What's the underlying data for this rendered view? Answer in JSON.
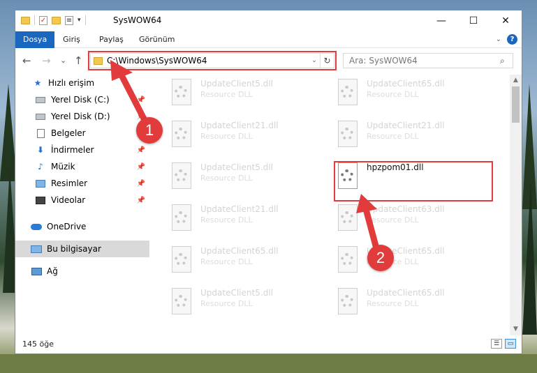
{
  "window": {
    "title": "SysWOW64",
    "controls": {
      "minimize": "—",
      "maximize": "☐",
      "close": "✕"
    }
  },
  "qat_icons": [
    "folder-icon",
    "checkmark-icon",
    "folder-icon",
    "properties-icon",
    "dropdown-icon"
  ],
  "ribbon": {
    "tabs": [
      "Dosya",
      "Giriş",
      "Paylaş",
      "Görünüm"
    ],
    "help": "?"
  },
  "nav": {
    "back": "←",
    "forward": "→",
    "recent": "⌄",
    "up": "↑",
    "address": "C:\\Windows\\SysWOW64",
    "refresh": "↻",
    "search_placeholder": "Ara: SysWOW64",
    "search_icon": "⌕"
  },
  "sidebar": {
    "items": [
      {
        "label": "Hızlı erişim",
        "icon": "star-icon",
        "pinned": false
      },
      {
        "label": "Yerel Disk (C:)",
        "icon": "drive-icon",
        "pinned": true
      },
      {
        "label": "Yerel Disk (D:)",
        "icon": "drive-icon",
        "pinned": true
      },
      {
        "label": "Belgeler",
        "icon": "documents-icon",
        "pinned": true
      },
      {
        "label": "İndirmeler",
        "icon": "downloads-icon",
        "pinned": true
      },
      {
        "label": "Müzik",
        "icon": "music-icon",
        "pinned": true
      },
      {
        "label": "Resimler",
        "icon": "pictures-icon",
        "pinned": true
      },
      {
        "label": "Videolar",
        "icon": "videos-icon",
        "pinned": true
      },
      {
        "label": "OneDrive",
        "icon": "onedrive-icon",
        "pinned": false
      },
      {
        "label": "Bu bilgisayar",
        "icon": "computer-icon",
        "pinned": false
      },
      {
        "label": "Ağ",
        "icon": "network-icon",
        "pinned": false
      }
    ],
    "selected": "Bu bilgisayar"
  },
  "files": [
    {
      "name": "UpdateClient5.dll",
      "type": "Resource DLL",
      "blurred": true
    },
    {
      "name": "UpdateClient65.dll",
      "type": "Resource DLL",
      "blurred": true
    },
    {
      "name": "UpdateClient21.dll",
      "type": "Resource DLL",
      "blurred": true
    },
    {
      "name": "UpdateClient21.dll",
      "type": "Resource DLL",
      "blurred": true
    },
    {
      "name": "UpdateClient5.dll",
      "type": "Resource DLL",
      "blurred": true
    },
    {
      "name": "hpzpom01.dll",
      "type": "",
      "blurred": false
    },
    {
      "name": "UpdateClient21.dll",
      "type": "Resource DLL",
      "blurred": true
    },
    {
      "name": "UpdateClient63.dll",
      "type": "Resource DLL",
      "blurred": true
    },
    {
      "name": "UpdateClient65.dll",
      "type": "Resource DLL",
      "blurred": true
    },
    {
      "name": "UpdateClient65.dll",
      "type": "Resource DLL",
      "blurred": true
    },
    {
      "name": "UpdateClient5.dll",
      "type": "Resource DLL",
      "blurred": true
    },
    {
      "name": "UpdateClient65.dll",
      "type": "Resource DLL",
      "blurred": true
    }
  ],
  "status": {
    "count": "145 öğe"
  },
  "annotations": {
    "step1": "1",
    "step2": "2",
    "color": "#e23b3b"
  },
  "colors": {
    "accent": "#1a67c0",
    "highlight": "#e23b3b"
  }
}
